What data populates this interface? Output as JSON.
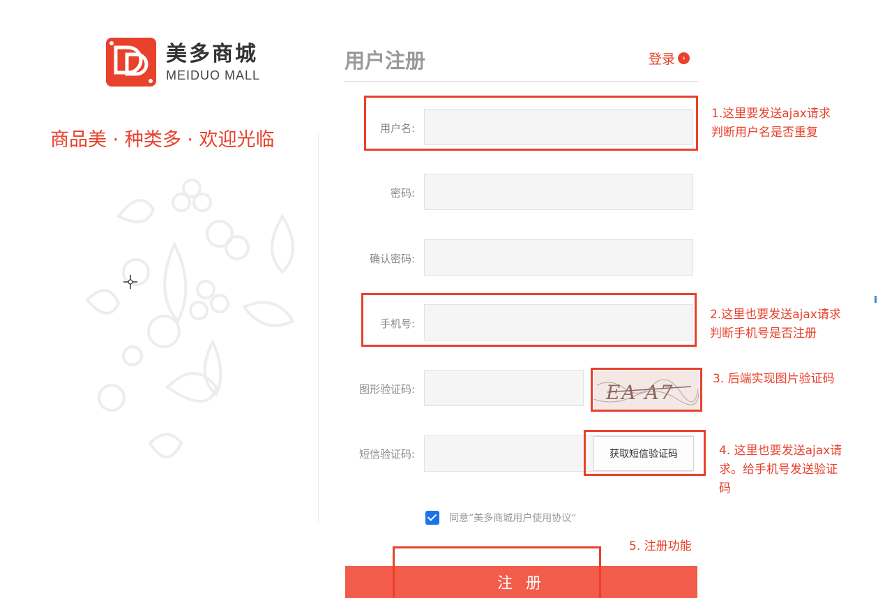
{
  "brand": {
    "logo_letters": "DD",
    "name_cn": "美多商城",
    "name_en": "MEIDUO MALL",
    "slogan": "商品美 · 种类多 · 欢迎光临"
  },
  "form": {
    "title": "用户注册",
    "login_link": "登录",
    "login_arrow": "›",
    "fields": {
      "username": {
        "label": "用户名:",
        "value": ""
      },
      "password": {
        "label": "密码:",
        "value": ""
      },
      "confirm_password": {
        "label": "确认密码:",
        "value": ""
      },
      "mobile": {
        "label": "手机号:",
        "value": ""
      },
      "image_code": {
        "label": "图形验证码:",
        "value": ""
      },
      "sms_code": {
        "label": "短信验证码:",
        "value": ""
      }
    },
    "captcha_text": "EA A7",
    "sms_button": "获取短信验证码",
    "agree_checked": true,
    "agree_text": "同意”美多商城用户使用协议“",
    "submit": "注 册"
  },
  "annotations": {
    "note1": [
      "1.这里要发送ajax请求",
      "判断用户名是否重复"
    ],
    "note2": [
      "2.这里也要发送ajax请求",
      "判断手机号是否注册"
    ],
    "note3": [
      "3.  后端实现图片验证码"
    ],
    "note4": [
      "4.  这里也要发送ajax请",
      "求。给手机号发送验证",
      "码"
    ],
    "note5": [
      "5.  注册功能"
    ]
  },
  "colors": {
    "brand_red": "#e8412c",
    "button_red": "#f25c4a",
    "checkbox_blue": "#1a73e8"
  },
  "icons": [
    "logo-dd-icon",
    "chevron-right-icon",
    "checkbox-checked-icon",
    "crosshair-cursor-icon",
    "food-decoration-icon"
  ]
}
